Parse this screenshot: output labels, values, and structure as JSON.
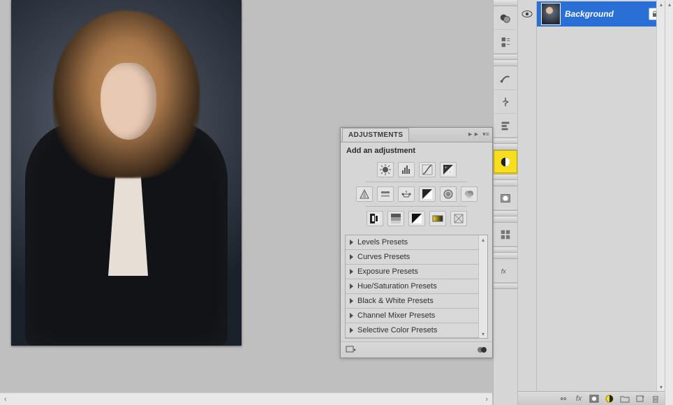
{
  "adjustments": {
    "panel_title": "ADJUSTMENTS",
    "heading": "Add an adjustment",
    "row1_icons": [
      "brightness-contrast-icon",
      "levels-icon",
      "curves-icon",
      "exposure-icon"
    ],
    "row2_icons": [
      "vibrance-icon",
      "hue-saturation-icon",
      "color-balance-icon",
      "black-white-icon",
      "photo-filter-icon",
      "channel-mixer-icon"
    ],
    "row3_icons": [
      "invert-icon",
      "posterize-icon",
      "threshold-icon",
      "gradient-map-icon",
      "selective-color-icon"
    ],
    "presets": [
      "Levels Presets",
      "Curves Presets",
      "Exposure Presets",
      "Hue/Saturation Presets",
      "Black & White Presets",
      "Channel Mixer Presets",
      "Selective Color Presets"
    ]
  },
  "layers": {
    "items": [
      {
        "name": "Background",
        "visible": true,
        "locked": true,
        "selected": true
      }
    ],
    "footer_icons": [
      "link-icon",
      "fx-icon",
      "mask-icon",
      "adjustment-icon",
      "group-icon",
      "new-layer-icon",
      "trash-icon"
    ]
  },
  "tool_strip": {
    "items": [
      {
        "name": "color-swatches-icon",
        "active": false
      },
      {
        "name": "paragraph-styles-icon",
        "active": false
      },
      {
        "name": "brush-preset-icon",
        "active": false
      },
      {
        "name": "clone-source-icon",
        "active": false
      },
      {
        "name": "tool-preset-icon",
        "active": false
      },
      {
        "name": "adjustments-icon",
        "active": true
      },
      {
        "name": "mask-panel-icon",
        "active": false
      },
      {
        "name": "channels-panel-icon",
        "active": false
      },
      {
        "name": "styles-panel-icon",
        "active": false
      }
    ]
  },
  "colors": {
    "selection_blue": "#2a6fd6",
    "accent_yellow": "#f7df1e"
  }
}
